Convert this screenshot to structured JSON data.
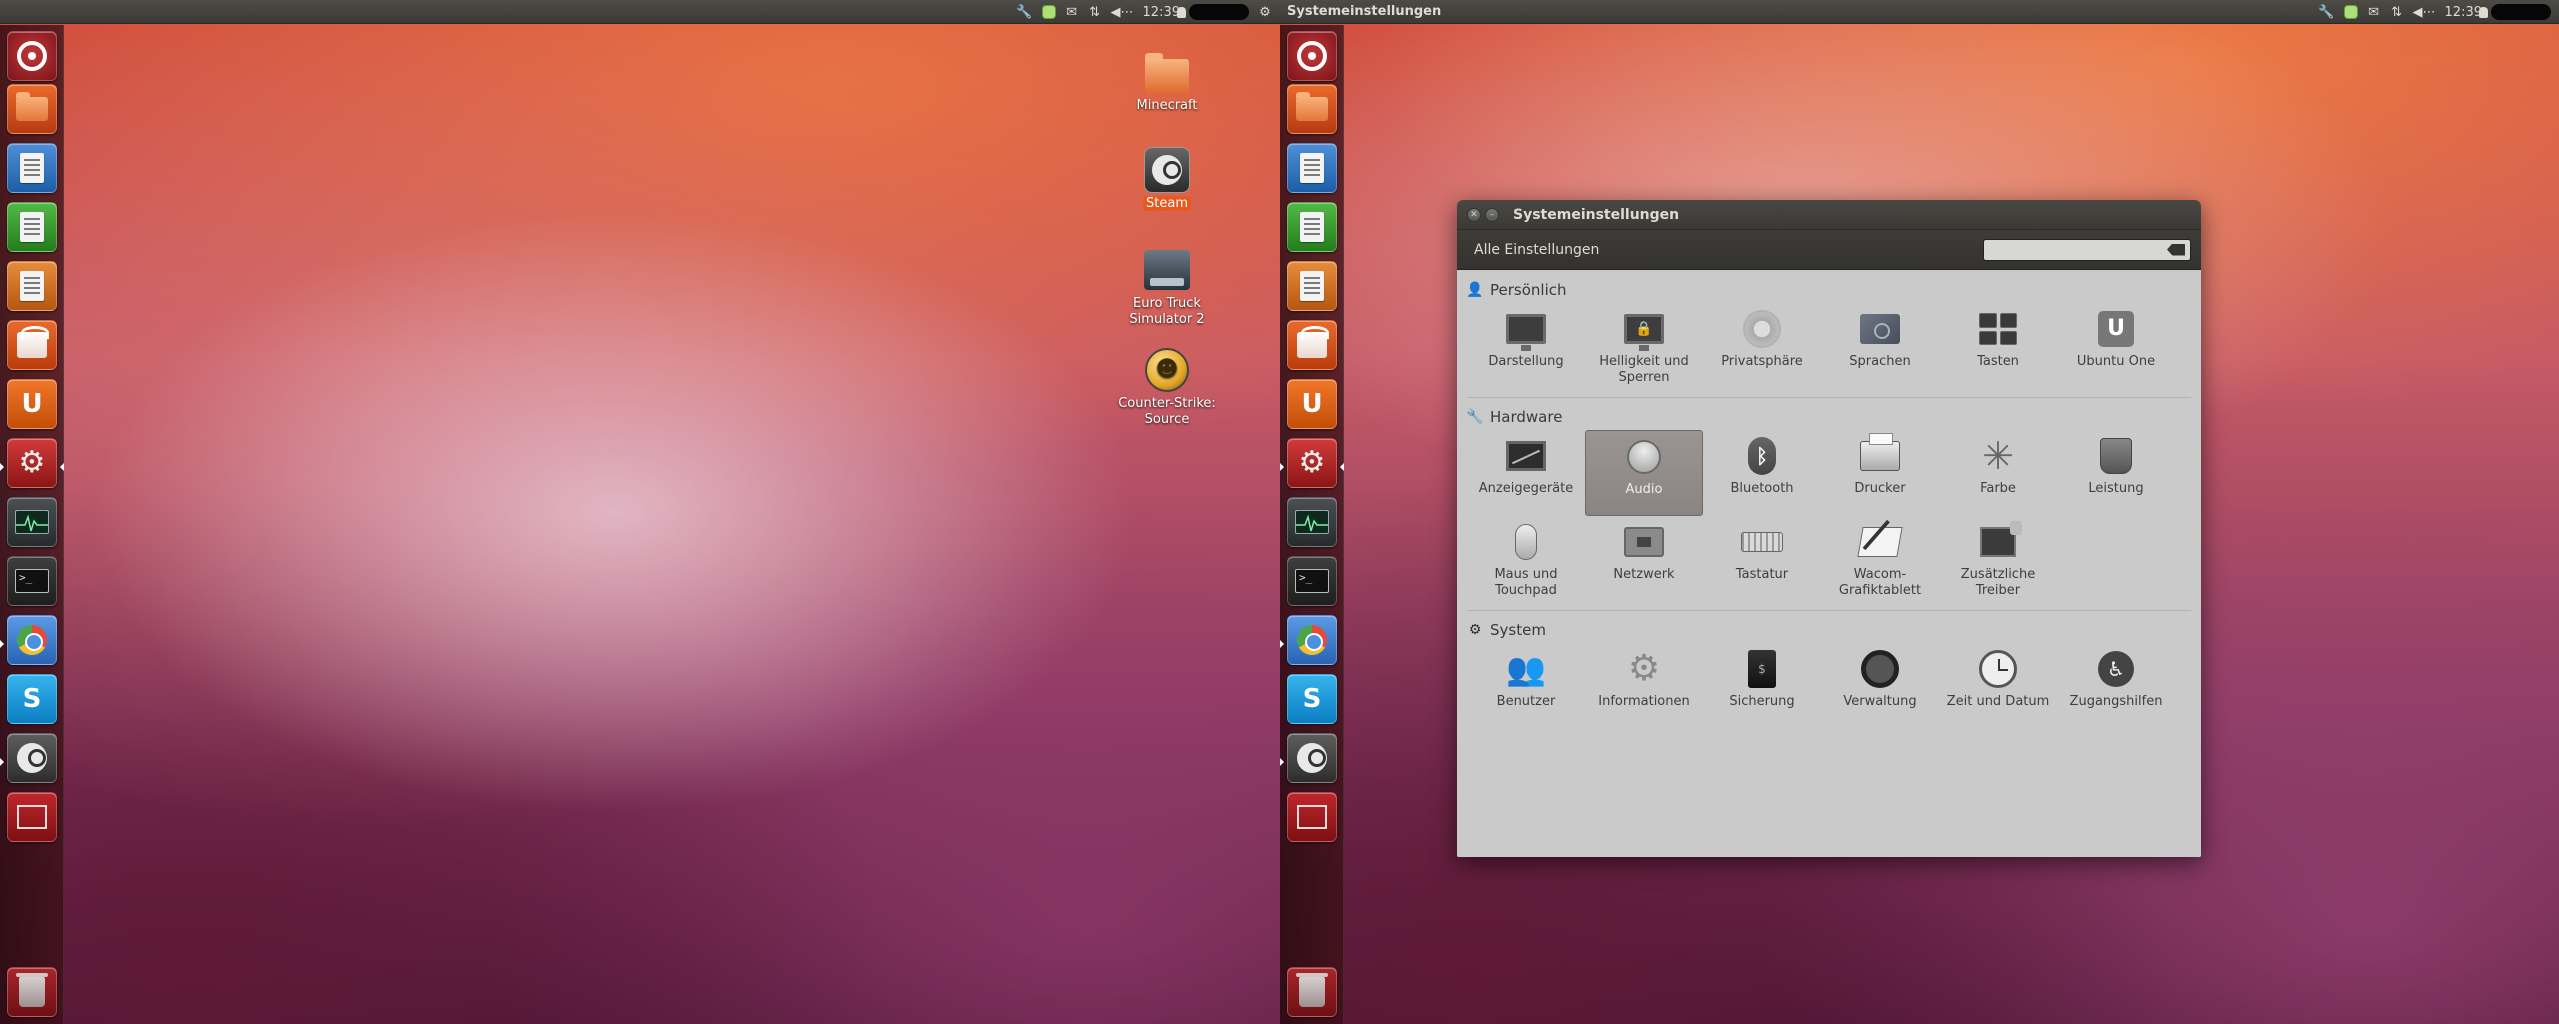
{
  "panel": {
    "time": "12:39",
    "window_title": "Systemeinstellungen",
    "indicators": {
      "steam": "🔧",
      "mail": "✉",
      "network": "⇅",
      "sound": "◀⋯",
      "gear": "⚙"
    }
  },
  "launcher": {
    "items": [
      {
        "name": "dash-home",
        "icon": "ubuntu-logo-icon"
      },
      {
        "name": "files",
        "icon": "folder-icon"
      },
      {
        "name": "writer",
        "icon": "document-writer-icon"
      },
      {
        "name": "calc",
        "icon": "spreadsheet-icon"
      },
      {
        "name": "impress",
        "icon": "presentation-icon"
      },
      {
        "name": "software-center",
        "icon": "shopping-bag-icon"
      },
      {
        "name": "ubuntu-one",
        "icon": "ubuntu-one-icon",
        "glyph": "U"
      },
      {
        "name": "system-settings",
        "icon": "settings-gear-icon"
      },
      {
        "name": "system-monitor",
        "icon": "system-monitor-icon"
      },
      {
        "name": "terminal",
        "icon": "terminal-icon",
        "glyph": ">_"
      },
      {
        "name": "chromium",
        "icon": "chromium-icon"
      },
      {
        "name": "skype",
        "icon": "skype-icon",
        "glyph": "S"
      },
      {
        "name": "steam",
        "icon": "steam-icon"
      },
      {
        "name": "workspaces",
        "icon": "workspace-switcher-icon"
      },
      {
        "name": "trash",
        "icon": "trash-icon"
      }
    ]
  },
  "desktop": {
    "icons": [
      {
        "label": "Minecraft",
        "icon": "folder-icon"
      },
      {
        "label": "Steam",
        "icon": "steam-icon",
        "selected": true
      },
      {
        "label": "Euro Truck Simulator 2",
        "icon": "truck-icon"
      },
      {
        "label": "Counter-Strike: Source",
        "icon": "counter-strike-icon"
      }
    ]
  },
  "settings_window": {
    "title": "Systemeinstellungen",
    "all_settings_label": "Alle Einstellungen",
    "search_value": "",
    "sections": [
      {
        "title": "Persönlich",
        "icon": "person-icon",
        "items": [
          {
            "label": "Darstellung",
            "icon": "monitor-icon"
          },
          {
            "label": "Helligkeit und Sperren",
            "icon": "monitor-lock-icon"
          },
          {
            "label": "Privatsphäre",
            "icon": "privacy-icon"
          },
          {
            "label": "Sprachen",
            "icon": "language-flag-icon"
          },
          {
            "label": "Tasten",
            "icon": "keyboard-keys-icon"
          },
          {
            "label": "Ubuntu One",
            "icon": "ubuntu-one-icon"
          }
        ]
      },
      {
        "title": "Hardware",
        "icon": "wrench-icon",
        "items": [
          {
            "label": "Anzeigegeräte",
            "icon": "display-icon"
          },
          {
            "label": "Audio",
            "icon": "speaker-icon",
            "selected": true
          },
          {
            "label": "Bluetooth",
            "icon": "bluetooth-icon"
          },
          {
            "label": "Drucker",
            "icon": "printer-icon"
          },
          {
            "label": "Farbe",
            "icon": "color-icon"
          },
          {
            "label": "Leistung",
            "icon": "power-icon"
          },
          {
            "label": "Maus und Touchpad",
            "icon": "mouse-icon"
          },
          {
            "label": "Netzwerk",
            "icon": "network-icon"
          },
          {
            "label": "Tastatur",
            "icon": "keyboard-icon"
          },
          {
            "label": "Wacom-Grafiktablett",
            "icon": "tablet-icon"
          },
          {
            "label": "Zusätzliche Treiber",
            "icon": "driver-chip-icon"
          }
        ]
      },
      {
        "title": "System",
        "icon": "system-icon",
        "items": [
          {
            "label": "Benutzer",
            "icon": "users-icon"
          },
          {
            "label": "Informationen",
            "icon": "info-gear-icon"
          },
          {
            "label": "Sicherung",
            "icon": "backup-safe-icon"
          },
          {
            "label": "Verwaltung",
            "icon": "administration-icon"
          },
          {
            "label": "Zeit und Datum",
            "icon": "clock-icon"
          },
          {
            "label": "Zugangshilfen",
            "icon": "accessibility-icon"
          }
        ]
      }
    ]
  }
}
